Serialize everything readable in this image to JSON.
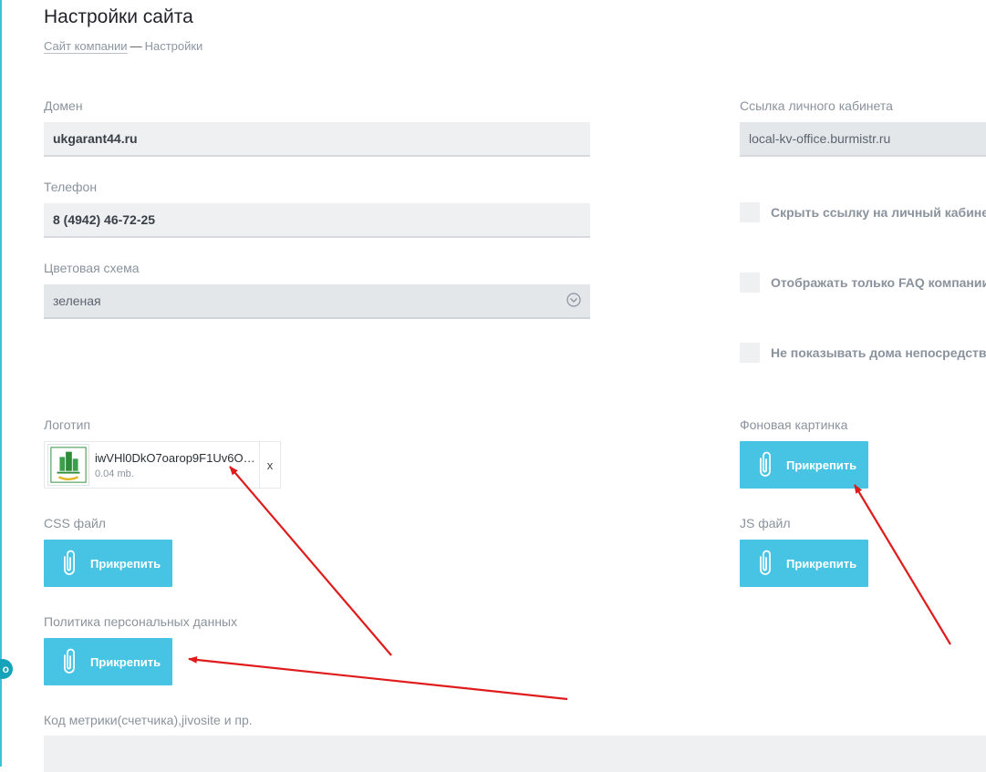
{
  "page": {
    "title": "Настройки сайта",
    "breadcrumb": {
      "link": "Сайт компании",
      "separator": "—",
      "current": "Настройки"
    }
  },
  "rail": {
    "badge": "o"
  },
  "form": {
    "domain": {
      "label": "Домен",
      "value": "ukgarant44.ru"
    },
    "phone": {
      "label": "Телефон",
      "value": "8 (4942) 46-72-25"
    },
    "color_scheme": {
      "label": "Цветовая схема",
      "value": "зеленая"
    },
    "cabinet_link": {
      "label": "Ссылка личного кабинета",
      "value": "local-kv-office.burmistr.ru"
    },
    "checkboxes": [
      {
        "label": "Скрыть ссылку на личный кабинет",
        "checked": false
      },
      {
        "label": "Отображать только FAQ компании",
        "checked": false
      },
      {
        "label": "Не показывать дома непосредствен",
        "checked": false
      }
    ],
    "logo": {
      "label": "Логотип",
      "file_name": "iwVHl0DkO7oarop9F1Uv6O…",
      "file_size": "0.04 mb.",
      "remove_label": "x"
    },
    "background": {
      "label": "Фоновая картинка",
      "button": "Прикрепить"
    },
    "css": {
      "label": "CSS файл",
      "button": "Прикрепить"
    },
    "js": {
      "label": "JS файл",
      "button": "Прикрепить"
    },
    "policy": {
      "label": "Политика персональных данных",
      "button": "Прикрепить"
    },
    "metrics": {
      "label": "Код метрики(счетчика),jivosite и пр.",
      "value": ""
    }
  },
  "colors": {
    "accent": "#47c4e3",
    "rail": "#3fc0d9",
    "annotation_arrow": "#e01b1b",
    "field_bg": "#eef0f2"
  },
  "icons": [
    "paperclip-icon",
    "chevron-down-icon",
    "close-icon",
    "logo-thumbnail-icon"
  ]
}
